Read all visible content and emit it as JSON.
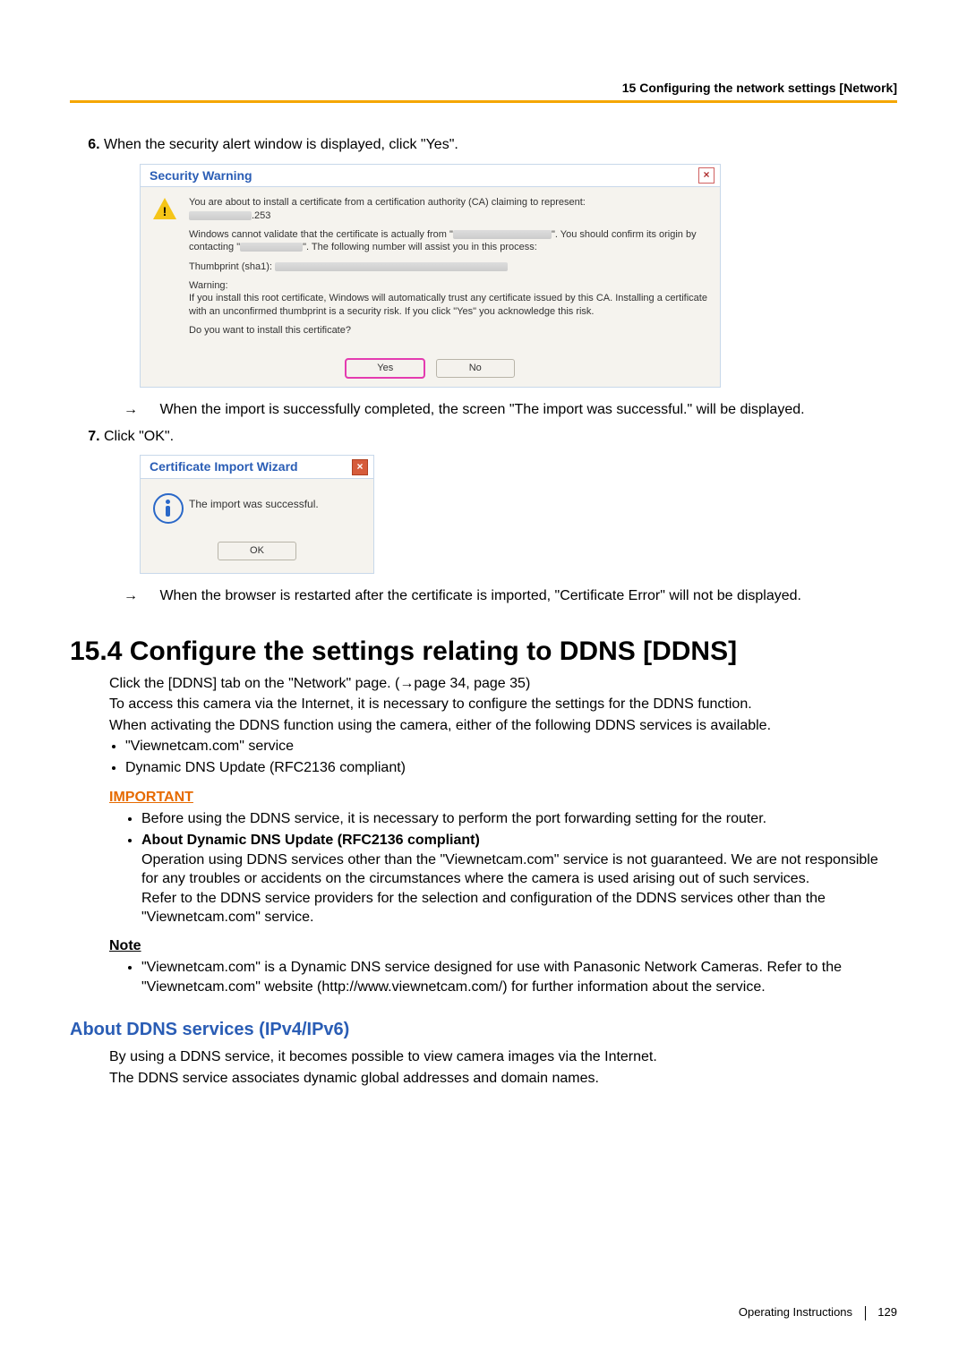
{
  "header": {
    "chapter": "15 Configuring the network settings [Network]"
  },
  "steps": {
    "s6": "When the security alert window is displayed, click \"Yes\".",
    "s6_result": "When the import is successfully completed, the screen \"The import was successful.\" will be displayed.",
    "s7": "Click \"OK\".",
    "s7_result": "When the browser is restarted after the certificate is imported, \"Certificate Error\" will not be displayed."
  },
  "arrow": "→",
  "security_dialog": {
    "title": "Security Warning",
    "l1": "You are about to install a certificate from a certification authority (CA) claiming to represent:",
    "l1b": ".253",
    "l2a": "Windows cannot validate that the certificate is actually from \"",
    "l2b": "\". You should confirm its origin by contacting \"",
    "l2c": "\". The following number will assist you in this process:",
    "l3": "Thumbprint (sha1): ",
    "l4": "Warning:",
    "l5": "If you install this root certificate, Windows will automatically trust any certificate issued by this CA. Installing a certificate with an unconfirmed thumbprint is a security risk. If you click \"Yes\" you acknowledge this risk.",
    "l6": "Do you want to install this certificate?",
    "yes": "Yes",
    "no": "No"
  },
  "import_dialog": {
    "title": "Certificate Import Wizard",
    "msg": "The import was successful.",
    "ok": "OK"
  },
  "section": {
    "title": "15.4  Configure the settings relating to DDNS [DDNS]",
    "p1": "Click the [DDNS] tab on the \"Network\" page. (→page 34, page 35)",
    "p2": "To access this camera via the Internet, it is necessary to configure the settings for the DDNS function.",
    "p3": "When activating the DDNS function using the camera, either of the following DDNS services is available.",
    "bullets": [
      "\"Viewnetcam.com\" service",
      "Dynamic DNS Update (RFC2136 compliant)"
    ]
  },
  "important": {
    "label": "IMPORTANT",
    "items": [
      {
        "text": "Before using the DDNS service, it is necessary to perform the port forwarding setting for the router."
      },
      {
        "bold": "About Dynamic DNS Update (RFC2136 compliant)",
        "text": "Operation using DDNS services other than the \"Viewnetcam.com\" service is not guaranteed. We are not responsible for any troubles or accidents on the circumstances where the camera is used arising out of such services.",
        "text2": "Refer to the DDNS service providers for the selection and configuration of the DDNS services other than the \"Viewnetcam.com\" service."
      }
    ]
  },
  "note": {
    "label": "Note",
    "items": [
      "\"Viewnetcam.com\" is a Dynamic DNS service designed for use with Panasonic Network Cameras. Refer to the \"Viewnetcam.com\" website (http://www.viewnetcam.com/) for further information about the service."
    ]
  },
  "sub": {
    "title": "About DDNS services (IPv4/IPv6)",
    "p1": "By using a DDNS service, it becomes possible to view camera images via the Internet.",
    "p2": "The DDNS service associates dynamic global addresses and domain names."
  },
  "footer": {
    "label": "Operating Instructions",
    "page": "129"
  }
}
